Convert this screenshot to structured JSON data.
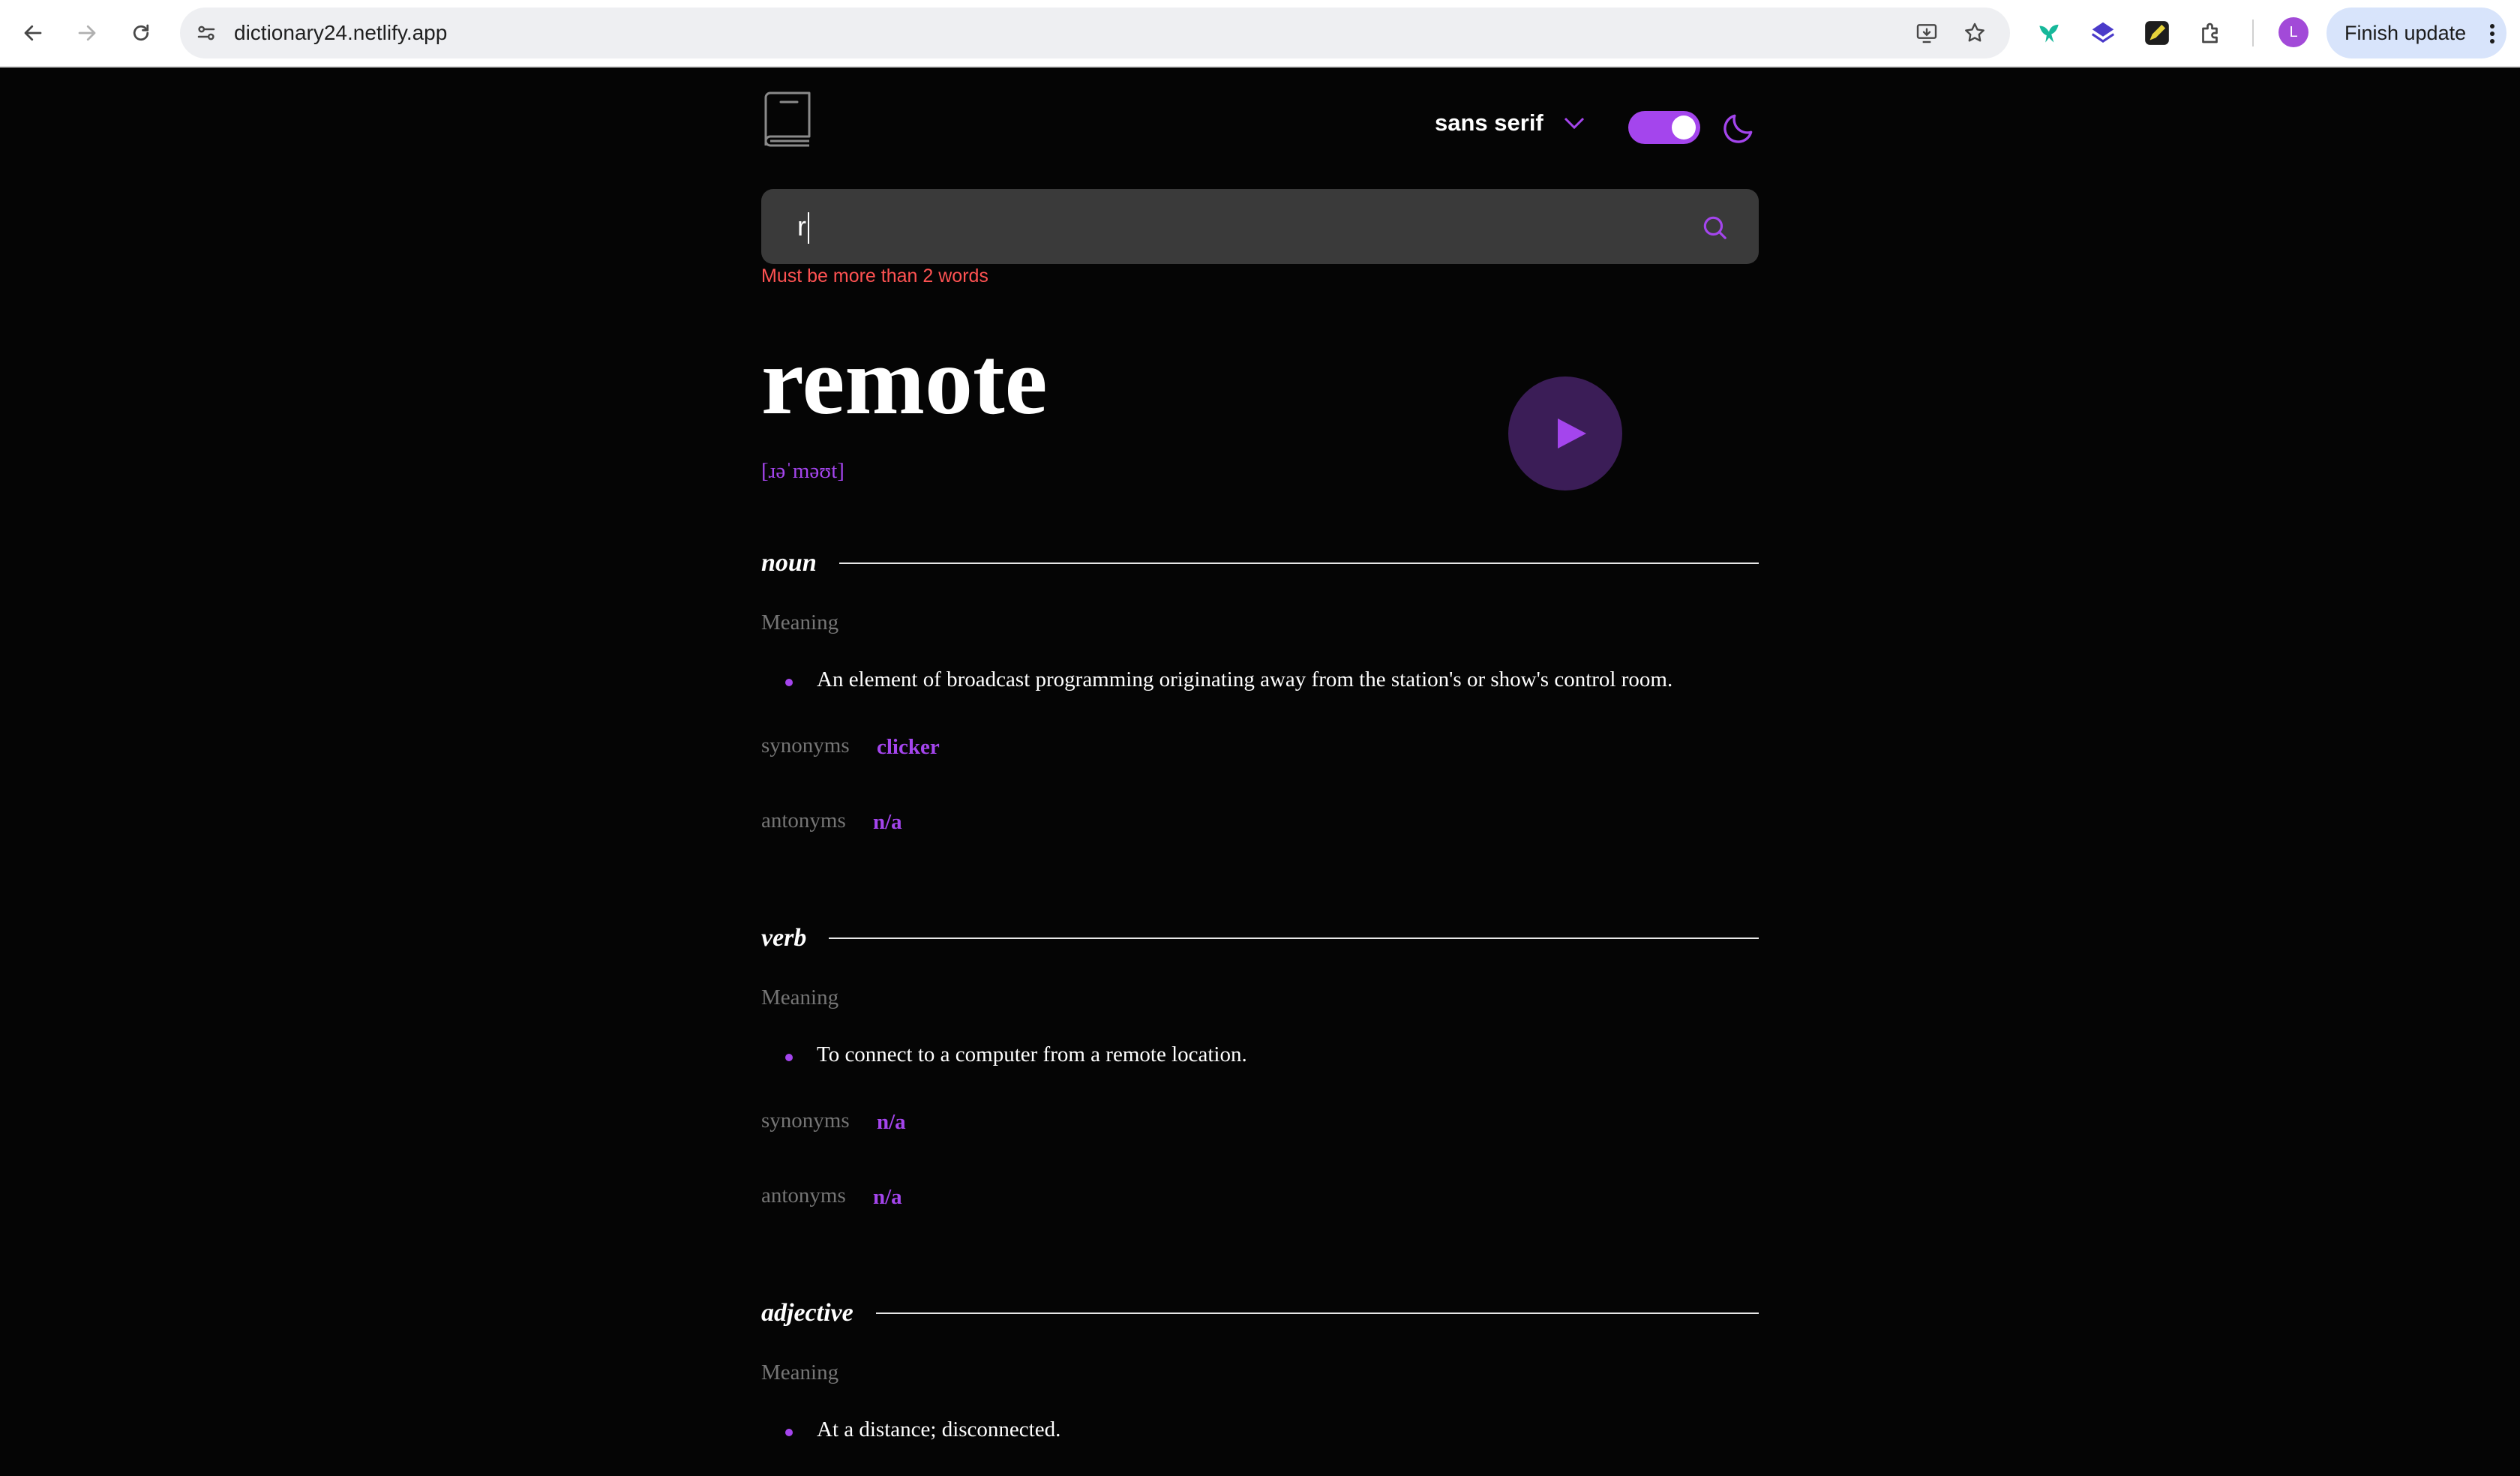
{
  "browser": {
    "url": "dictionary24.netlify.app",
    "avatar_letter": "L",
    "finish_update_label": "Finish update"
  },
  "header": {
    "font_label": "sans serif",
    "theme_toggle_on": true
  },
  "search": {
    "query": "r",
    "error": "Must be more than 2 words"
  },
  "entry": {
    "word": "remote",
    "phonetic": "[ɹəˈməʊt]",
    "meaning_label": "Meaning",
    "synonyms_label": "synonyms",
    "antonyms_label": "antonyms",
    "meanings": [
      {
        "part_of_speech": "noun",
        "definition": "An element of broadcast programming originating away from the station's or show's control room.",
        "synonyms": "clicker",
        "antonyms": "n/a"
      },
      {
        "part_of_speech": "verb",
        "definition": "To connect to a computer from a remote location.",
        "synonyms": "n/a",
        "antonyms": "n/a"
      },
      {
        "part_of_speech": "adjective",
        "definition": "At a distance; disconnected."
      }
    ]
  },
  "colors": {
    "accent": "#a445ed",
    "background": "#050505",
    "error": "#ff5252",
    "muted": "#757575"
  }
}
